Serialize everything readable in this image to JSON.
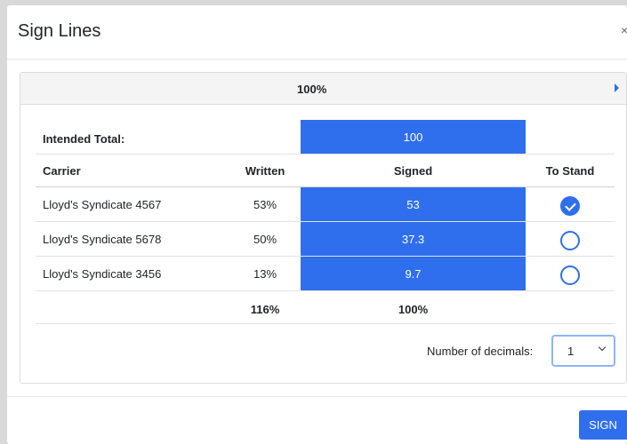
{
  "modal": {
    "title": "Sign Lines",
    "close_label": "×"
  },
  "panel": {
    "header_label": "100%"
  },
  "table": {
    "intended_total_label": "Intended Total:",
    "intended_total_value": "100",
    "columns": {
      "carrier": "Carrier",
      "written": "Written",
      "signed": "Signed",
      "to_stand": "To Stand"
    },
    "rows": [
      {
        "carrier": "Lloyd's Syndicate 4567",
        "written": "53%",
        "signed": "53",
        "to_stand": true
      },
      {
        "carrier": "Lloyd's Syndicate 5678",
        "written": "50%",
        "signed": "37.3",
        "to_stand": false
      },
      {
        "carrier": "Lloyd's Syndicate 3456",
        "written": "13%",
        "signed": "9.7",
        "to_stand": false
      }
    ],
    "totals": {
      "written": "116%",
      "signed": "100%"
    }
  },
  "decimals": {
    "label": "Number of decimals:",
    "value": "1"
  },
  "footer": {
    "sign_label": "SIGN"
  },
  "colors": {
    "accent": "#2f6fed",
    "backdrop": "#d9d9d9"
  },
  "icons": {
    "close": "close-icon",
    "expand": "caret-right-icon",
    "dropdown": "chevron-down-icon",
    "check": "check-icon"
  }
}
